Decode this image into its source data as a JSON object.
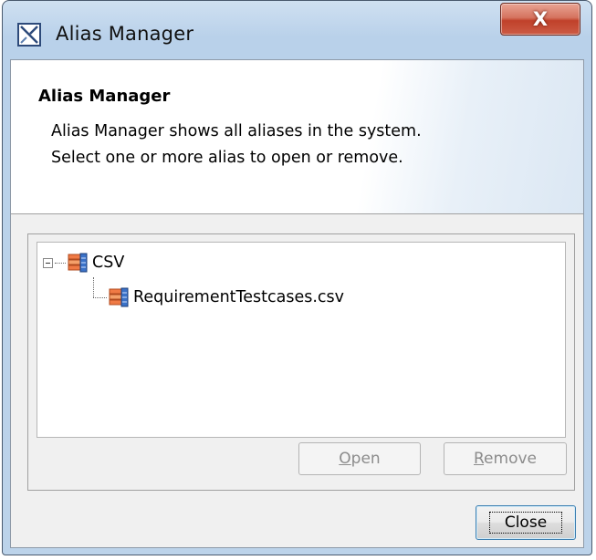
{
  "window": {
    "title": "Alias Manager",
    "close_glyph": "X",
    "title_icon": "alias-manager-icon"
  },
  "header": {
    "title": "Alias Manager",
    "description": "Alias Manager shows all aliases in the system. Select one or more alias to open or remove."
  },
  "tree": {
    "root": {
      "label": "CSV",
      "icon": "database-icon",
      "expanded": true
    },
    "children": [
      {
        "label": "RequirementTestcases.csv",
        "icon": "database-icon"
      }
    ]
  },
  "buttons": {
    "open": {
      "mnemonic": "O",
      "rest": "pen",
      "enabled": false
    },
    "remove": {
      "mnemonic": "R",
      "rest": "emove",
      "enabled": false
    },
    "close": {
      "label": "Close",
      "enabled": true,
      "default": true
    }
  },
  "colors": {
    "title_bar": "#b9d1ea",
    "close_button": "#c0412a",
    "dialog_bg": "#f0f0f0",
    "focus_border": "#3c7fb1"
  }
}
